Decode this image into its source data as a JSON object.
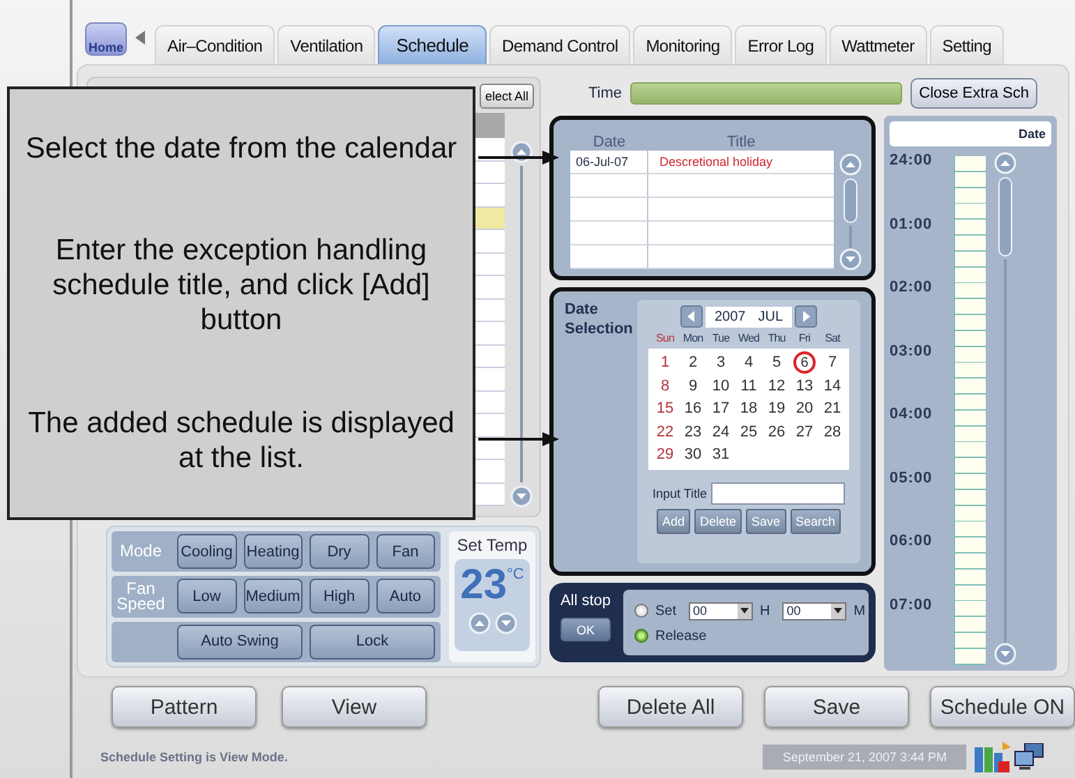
{
  "tabs": {
    "home": "Home",
    "items": [
      {
        "label": "Air–Condition",
        "selected": false
      },
      {
        "label": "Ventilation",
        "selected": false
      },
      {
        "label": "Schedule",
        "selected": true
      },
      {
        "label": "Demand Control",
        "selected": false
      },
      {
        "label": "Monitoring",
        "selected": false
      },
      {
        "label": "Error Log",
        "selected": false
      },
      {
        "label": "Wattmeter",
        "selected": false
      },
      {
        "label": "Setting",
        "selected": false
      }
    ]
  },
  "left_panel": {
    "select_all": "elect All",
    "rows": [
      {
        "selected": false
      },
      {
        "selected": false
      },
      {
        "selected": false
      },
      {
        "selected": true
      },
      {
        "selected": false
      },
      {
        "selected": false
      },
      {
        "selected": false
      },
      {
        "selected": false
      },
      {
        "selected": false
      },
      {
        "selected": false
      },
      {
        "selected": false
      },
      {
        "selected": false
      },
      {
        "selected": false
      },
      {
        "selected": false
      },
      {
        "selected": false
      },
      {
        "selected": false
      }
    ]
  },
  "controls": {
    "rows": [
      {
        "label": "Mode",
        "options": [
          "Cooling",
          "Heating",
          "Dry",
          "Fan"
        ]
      },
      {
        "label": "Fan Speed",
        "options": [
          "Low",
          "Medium",
          "High",
          "Auto"
        ]
      },
      {
        "options": [
          "Auto Swing",
          "Lock"
        ]
      }
    ],
    "set_temp": {
      "label": "Set Temp",
      "value": "23",
      "unit": "°C"
    }
  },
  "left_buttons": [
    "Pattern",
    "View"
  ],
  "time_bar": {
    "label": "Time",
    "close_button": "Close Extra Sch"
  },
  "exception_list": {
    "columns": [
      "Date",
      "Title"
    ],
    "rows": [
      {
        "date": "06-Jul-07",
        "title": "Descretional holiday"
      }
    ]
  },
  "date_selection": {
    "label": "Date Selection",
    "year": "2007",
    "month": "JUL",
    "weekdays": [
      "Sun",
      "Mon",
      "Tue",
      "Wed",
      "Thu",
      "Fri",
      "Sat"
    ],
    "days": [
      {
        "day": "1",
        "selected": false
      },
      {
        "day": "2",
        "selected": false
      },
      {
        "day": "3",
        "selected": false
      },
      {
        "day": "4",
        "selected": false
      },
      {
        "day": "5",
        "selected": false
      },
      {
        "day": "6",
        "selected": true
      },
      {
        "day": "7",
        "selected": false
      },
      {
        "day": "8",
        "selected": false
      },
      {
        "day": "9",
        "selected": false
      },
      {
        "day": "10",
        "selected": false
      },
      {
        "day": "11",
        "selected": false
      },
      {
        "day": "12",
        "selected": false
      },
      {
        "day": "13",
        "selected": false
      },
      {
        "day": "14",
        "selected": false
      },
      {
        "day": "15",
        "selected": false
      },
      {
        "day": "16",
        "selected": false
      },
      {
        "day": "17",
        "selected": false
      },
      {
        "day": "18",
        "selected": false
      },
      {
        "day": "19",
        "selected": false
      },
      {
        "day": "20",
        "selected": false
      },
      {
        "day": "21",
        "selected": false
      },
      {
        "day": "22",
        "selected": false
      },
      {
        "day": "23",
        "selected": false
      },
      {
        "day": "24",
        "selected": false
      },
      {
        "day": "25",
        "selected": false
      },
      {
        "day": "26",
        "selected": false
      },
      {
        "day": "27",
        "selected": false
      },
      {
        "day": "28",
        "selected": false
      },
      {
        "day": "29",
        "selected": false
      },
      {
        "day": "30",
        "selected": false
      },
      {
        "day": "31",
        "selected": false
      }
    ],
    "input_label": "Input Title",
    "buttons": [
      "Add",
      "Delete",
      "Save",
      "Search"
    ]
  },
  "all_stop": {
    "label": "All stop",
    "ok": "OK",
    "options": [
      {
        "kind": "timed",
        "label": "Set",
        "selected": false
      },
      {
        "kind": "plain",
        "label": "Release",
        "selected": true
      }
    ],
    "hour": "00",
    "hour_unit": "H",
    "minute": "00",
    "minute_unit": "M"
  },
  "timeline": {
    "header": "Date",
    "times": [
      "24:00",
      "01:00",
      "02:00",
      "03:00",
      "04:00",
      "05:00",
      "06:00",
      "07:00"
    ]
  },
  "bottom_buttons": [
    "Delete All",
    "Save",
    "Schedule ON"
  ],
  "status_bar": {
    "message": "Schedule Setting is View Mode.",
    "datetime": "September 21, 2007 3:44 PM"
  },
  "callout": {
    "notes": [
      "Select the date from the calendar",
      "Enter the exception handling schedule title, and click [Add] button",
      "The added schedule is displayed at the list."
    ]
  }
}
